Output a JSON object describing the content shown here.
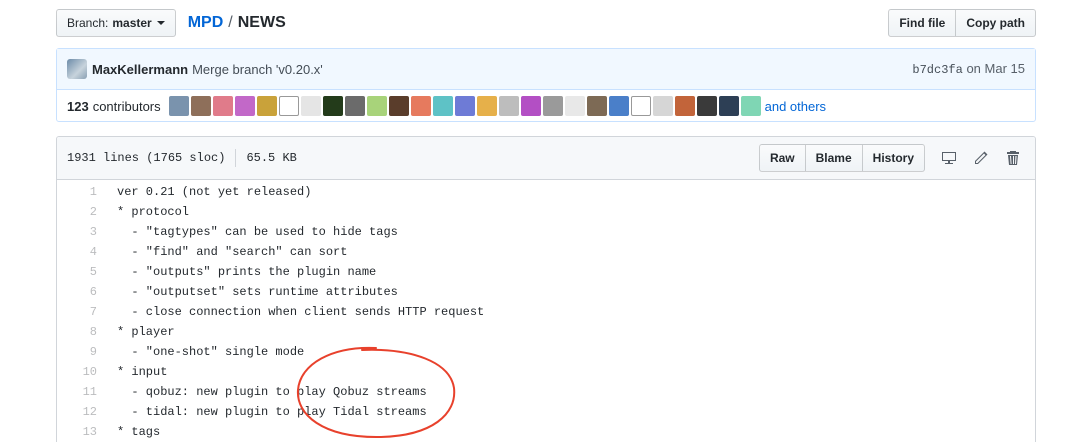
{
  "branch": {
    "label": "Branch:",
    "name": "master"
  },
  "breadcrumb": {
    "repo": "MPD",
    "separator": "/",
    "file": "NEWS"
  },
  "file_buttons": {
    "find_file": "Find file",
    "copy_path": "Copy path"
  },
  "commit": {
    "author": "MaxKellermann",
    "message": "Merge branch 'v0.20.x'",
    "sha": "b7dc3fa",
    "date": "on Mar 15"
  },
  "contributors": {
    "count": "123",
    "label": "contributors",
    "others": "and others",
    "avatar_colors": [
      "#7a93ad",
      "#8e6f5a",
      "#e07b8a",
      "#c268c8",
      "#c9a23a",
      "#ffffff",
      "#e5e5e5",
      "#233b1a",
      "#6b6b6b",
      "#a8d37a",
      "#5a3d2b",
      "#e67a5e",
      "#5ec2c6",
      "#6e7bd6",
      "#e6b04a",
      "#bdbdbd",
      "#b34fc4",
      "#9a9a9a",
      "#e8e8e8",
      "#7d6a55",
      "#4a7fc9",
      "#ffffff",
      "#d6d6d6",
      "#c2643a",
      "#3a3a3a",
      "#2d3f55",
      "#7fd6b4"
    ]
  },
  "file": {
    "lines": "1931 lines (1765 sloc)",
    "size": "65.5 KB",
    "raw": "Raw",
    "blame": "Blame",
    "history": "History",
    "icons": [
      "desktop-icon",
      "pencil-icon",
      "trash-icon"
    ]
  },
  "code_lines": [
    {
      "n": "1",
      "text": "ver 0.21 (not yet released)"
    },
    {
      "n": "2",
      "text": "* protocol"
    },
    {
      "n": "3",
      "text": "  - \"tagtypes\" can be used to hide tags"
    },
    {
      "n": "4",
      "text": "  - \"find\" and \"search\" can sort"
    },
    {
      "n": "5",
      "text": "  - \"outputs\" prints the plugin name"
    },
    {
      "n": "6",
      "text": "  - \"outputset\" sets runtime attributes"
    },
    {
      "n": "7",
      "text": "  - close connection when client sends HTTP request"
    },
    {
      "n": "8",
      "text": "* player"
    },
    {
      "n": "9",
      "text": "  - \"one-shot\" single mode"
    },
    {
      "n": "10",
      "text": "* input"
    },
    {
      "n": "11",
      "text": "  - qobuz: new plugin to play Qobuz streams"
    },
    {
      "n": "12",
      "text": "  - tidal: new plugin to play Tidal streams"
    },
    {
      "n": "13",
      "text": "* tags"
    }
  ],
  "colors": {
    "link": "#0366d6",
    "annotation": "#e8412c"
  }
}
